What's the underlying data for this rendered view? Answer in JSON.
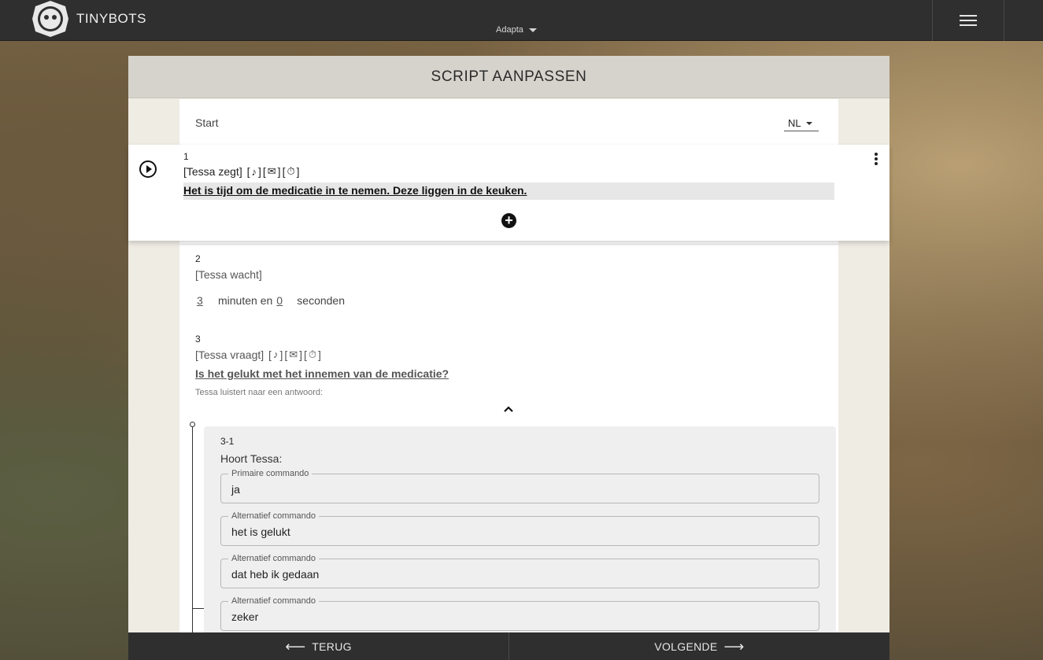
{
  "header": {
    "brand": "TINYBOTS",
    "organization": "Adapta"
  },
  "page": {
    "title": "SCRIPT AANPASSEN",
    "start_label": "Start",
    "language": "NL"
  },
  "steps": [
    {
      "number": "1",
      "actor": "[Tessa zegt]",
      "icons": [
        "music-note-icon",
        "message-icon",
        "timer-icon"
      ],
      "text": "Het is tijd om de medicatie in te nemen. Deze liggen in de keuken."
    },
    {
      "number": "2",
      "actor": "[Tessa wacht]",
      "minutes": "3",
      "minutes_label": "minuten en",
      "seconds": "0",
      "seconds_label": "seconden"
    },
    {
      "number": "3",
      "actor": "[Tessa vraagt]",
      "icons": [
        "music-note-icon",
        "message-off-icon",
        "timer-off-icon"
      ],
      "text": "Is het gelukt met het innemen van de medicatie?",
      "listen_label": "Tessa luistert naar een antwoord:"
    }
  ],
  "response": {
    "number": "3-1",
    "label": "Hoort Tessa:",
    "fields": [
      {
        "label": "Primaire commando",
        "value": "ja"
      },
      {
        "label": "Alternatief commando",
        "value": "het is gelukt"
      },
      {
        "label": "Alternatief commando",
        "value": "dat heb ik gedaan"
      },
      {
        "label": "Alternatief commando",
        "value": "zeker"
      }
    ]
  },
  "nav": {
    "back": "TERUG",
    "next": "VOLGENDE"
  }
}
